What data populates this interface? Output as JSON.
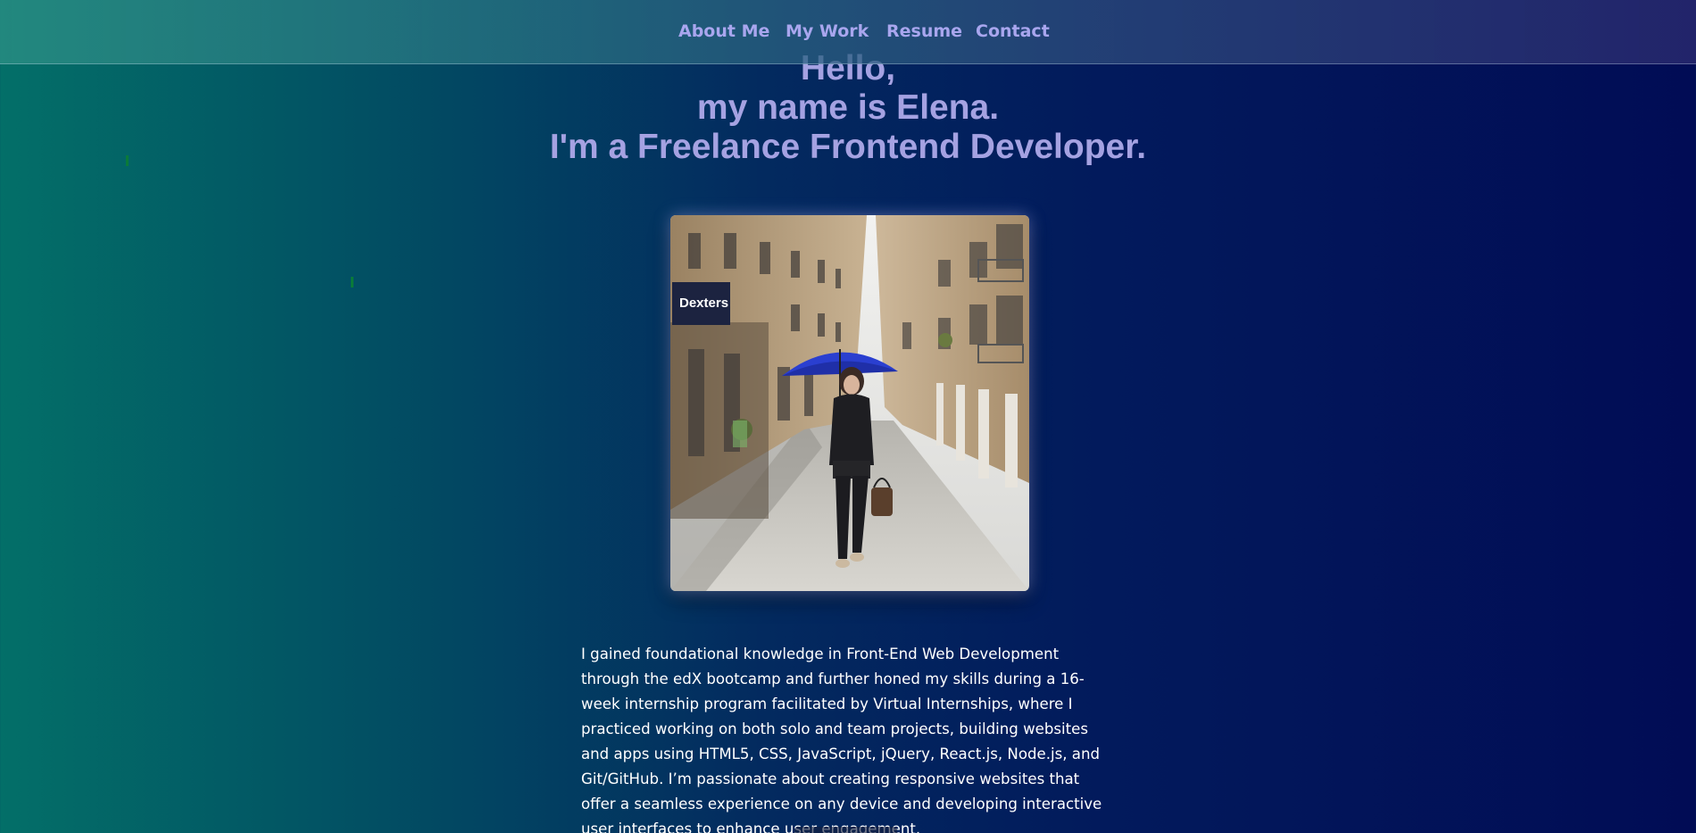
{
  "nav": {
    "items": [
      {
        "label": "About Me"
      },
      {
        "label": "My Work"
      },
      {
        "label": "Resume"
      },
      {
        "label": "Contact"
      }
    ]
  },
  "hero": {
    "line1": "Hello,",
    "line2": "my name is Elena.",
    "line3": "I'm a Freelance Frontend Developer."
  },
  "photo": {
    "sign_text": "Dexters"
  },
  "bio": {
    "text": "I gained foundational knowledge in Front-End Web Development through the edX bootcamp and further honed my skills during a 16-week internship program facilitated by Virtual Internships, where I practiced working on both solo and team projects, building websites and apps using HTML5, CSS, JavaScript, jQuery, React.js, Node.js, and Git/GitHub. I’m passionate about creating responsive websites that offer a seamless experience on any device and developing interactive user interfaces to enhance user engagement."
  },
  "colors": {
    "nav_link": "#a9a6ee",
    "hero_text": "#a5a2e2",
    "bio_text": "#ffffff",
    "umbrella": "#2a3fd0"
  }
}
